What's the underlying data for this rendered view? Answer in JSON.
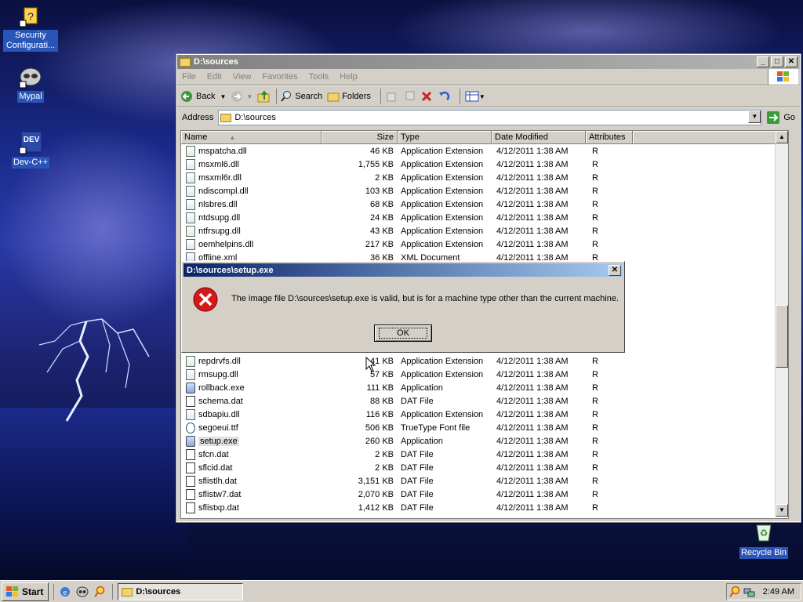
{
  "desktop": {
    "icons": [
      {
        "label": "Security Configurati..."
      },
      {
        "label": "Mypal"
      },
      {
        "label": "Dev-C++"
      },
      {
        "label": "Recycle Bin"
      }
    ],
    "dev_icon_text": "DEV"
  },
  "explorer": {
    "title": "D:\\sources",
    "menu": [
      "File",
      "Edit",
      "View",
      "Favorites",
      "Tools",
      "Help"
    ],
    "toolbar": {
      "back": "Back",
      "search": "Search",
      "folders": "Folders"
    },
    "address_label": "Address",
    "address_value": "D:\\sources",
    "go_label": "Go",
    "columns": [
      "Name",
      "Size",
      "Type",
      "Date Modified",
      "Attributes"
    ],
    "files_top": [
      {
        "name": "mspatcha.dll",
        "size": "46 KB",
        "type": "Application Extension",
        "date": "4/12/2011 1:38 AM",
        "attr": "R",
        "icon": "dll"
      },
      {
        "name": "msxml6.dll",
        "size": "1,755 KB",
        "type": "Application Extension",
        "date": "4/12/2011 1:38 AM",
        "attr": "R",
        "icon": "dll"
      },
      {
        "name": "msxml6r.dll",
        "size": "2 KB",
        "type": "Application Extension",
        "date": "4/12/2011 1:38 AM",
        "attr": "R",
        "icon": "dll"
      },
      {
        "name": "ndiscompl.dll",
        "size": "103 KB",
        "type": "Application Extension",
        "date": "4/12/2011 1:38 AM",
        "attr": "R",
        "icon": "dll"
      },
      {
        "name": "nlsbres.dll",
        "size": "68 KB",
        "type": "Application Extension",
        "date": "4/12/2011 1:38 AM",
        "attr": "R",
        "icon": "dll"
      },
      {
        "name": "ntdsupg.dll",
        "size": "24 KB",
        "type": "Application Extension",
        "date": "4/12/2011 1:38 AM",
        "attr": "R",
        "icon": "dll"
      },
      {
        "name": "ntfrsupg.dll",
        "size": "43 KB",
        "type": "Application Extension",
        "date": "4/12/2011 1:38 AM",
        "attr": "R",
        "icon": "dll"
      },
      {
        "name": "oemhelpins.dll",
        "size": "217 KB",
        "type": "Application Extension",
        "date": "4/12/2011 1:38 AM",
        "attr": "R",
        "icon": "dll"
      },
      {
        "name": "offline.xml",
        "size": "36 KB",
        "type": "XML Document",
        "date": "4/12/2011 1:38 AM",
        "attr": "R",
        "icon": "xml"
      }
    ],
    "files_bottom": [
      {
        "name": "repdrvfs.dll",
        "size": "41 KB",
        "type": "Application Extension",
        "date": "4/12/2011 1:38 AM",
        "attr": "R",
        "icon": "dll"
      },
      {
        "name": "rmsupg.dll",
        "size": "57 KB",
        "type": "Application Extension",
        "date": "4/12/2011 1:38 AM",
        "attr": "R",
        "icon": "dll"
      },
      {
        "name": "rollback.exe",
        "size": "111 KB",
        "type": "Application",
        "date": "4/12/2011 1:38 AM",
        "attr": "R",
        "icon": "exe"
      },
      {
        "name": "schema.dat",
        "size": "88 KB",
        "type": "DAT File",
        "date": "4/12/2011 1:38 AM",
        "attr": "R",
        "icon": "dat"
      },
      {
        "name": "sdbapiu.dll",
        "size": "116 KB",
        "type": "Application Extension",
        "date": "4/12/2011 1:38 AM",
        "attr": "R",
        "icon": "dll"
      },
      {
        "name": "segoeui.ttf",
        "size": "506 KB",
        "type": "TrueType Font file",
        "date": "4/12/2011 1:38 AM",
        "attr": "R",
        "icon": "ttf"
      },
      {
        "name": "setup.exe",
        "size": "260 KB",
        "type": "Application",
        "date": "4/12/2011 1:38 AM",
        "attr": "R",
        "icon": "exe",
        "selected": true
      },
      {
        "name": "sfcn.dat",
        "size": "2 KB",
        "type": "DAT File",
        "date": "4/12/2011 1:38 AM",
        "attr": "R",
        "icon": "dat"
      },
      {
        "name": "sflcid.dat",
        "size": "2 KB",
        "type": "DAT File",
        "date": "4/12/2011 1:38 AM",
        "attr": "R",
        "icon": "dat"
      },
      {
        "name": "sflistlh.dat",
        "size": "3,151 KB",
        "type": "DAT File",
        "date": "4/12/2011 1:38 AM",
        "attr": "R",
        "icon": "dat"
      },
      {
        "name": "sflistw7.dat",
        "size": "2,070 KB",
        "type": "DAT File",
        "date": "4/12/2011 1:38 AM",
        "attr": "R",
        "icon": "dat"
      },
      {
        "name": "sflistxp.dat",
        "size": "1,412 KB",
        "type": "DAT File",
        "date": "4/12/2011 1:38 AM",
        "attr": "R",
        "icon": "dat"
      }
    ]
  },
  "dialog": {
    "title": "D:\\sources\\setup.exe",
    "message": "The image file D:\\sources\\setup.exe is valid, but is for a machine type other than the current machine.",
    "ok_label": "OK"
  },
  "taskbar": {
    "start_label": "Start",
    "task_label": "D:\\sources",
    "clock": "2:49 AM"
  }
}
